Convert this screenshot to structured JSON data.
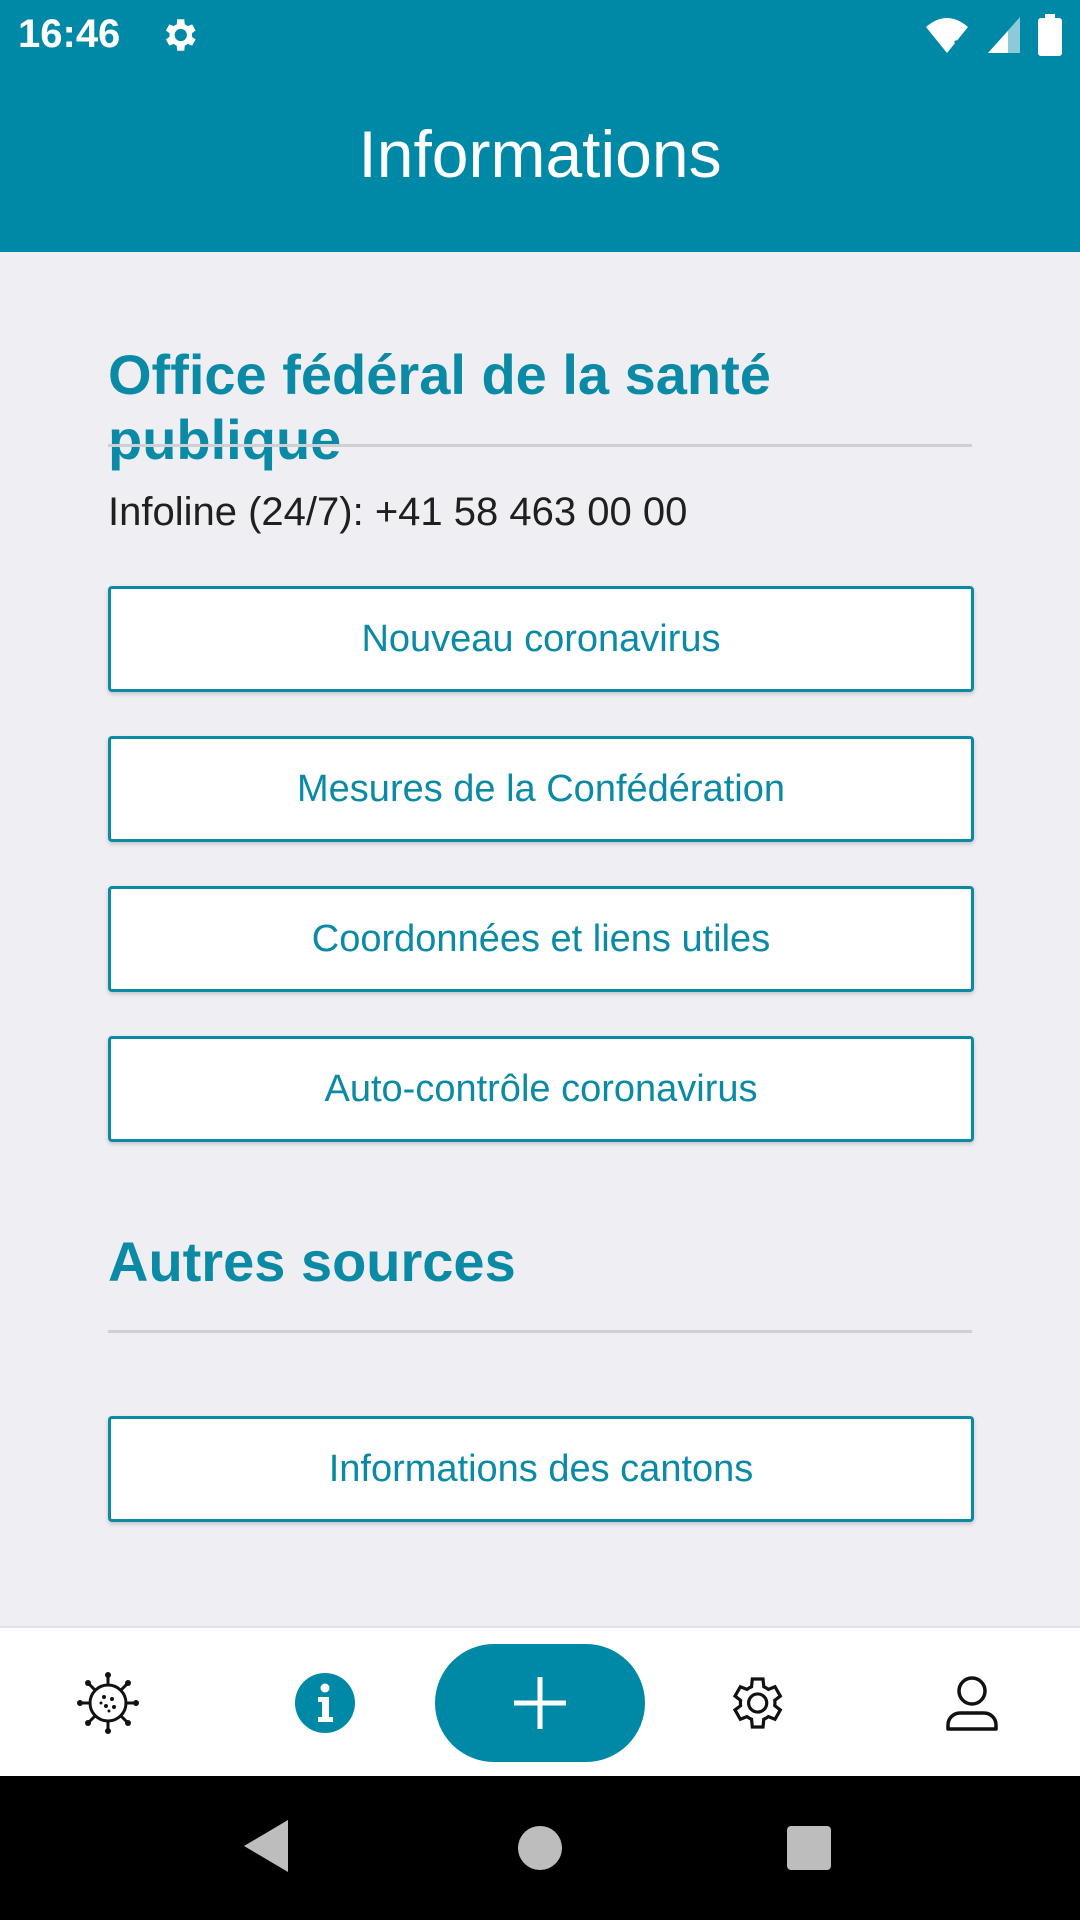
{
  "status": {
    "time": "16:46"
  },
  "header": {
    "title": "Informations"
  },
  "section1": {
    "title": "Office fédéral de la santé publique",
    "infoline": "Infoline (24/7): +41 58 463 00 00",
    "buttons": [
      "Nouveau coronavirus",
      "Mesures de la Confédération",
      "Coordonnées et liens utiles",
      "Auto-contrôle coronavirus"
    ]
  },
  "section2": {
    "title": "Autres sources",
    "buttons": [
      "Informations des cantons"
    ]
  },
  "nav": {
    "items": [
      "virus-icon",
      "info-icon",
      "plus-icon",
      "gear-icon",
      "person-icon"
    ],
    "active": "info-icon"
  },
  "colors": {
    "primary": "#0089a6",
    "background": "#eeeef3",
    "text": "#1f1f1f"
  }
}
